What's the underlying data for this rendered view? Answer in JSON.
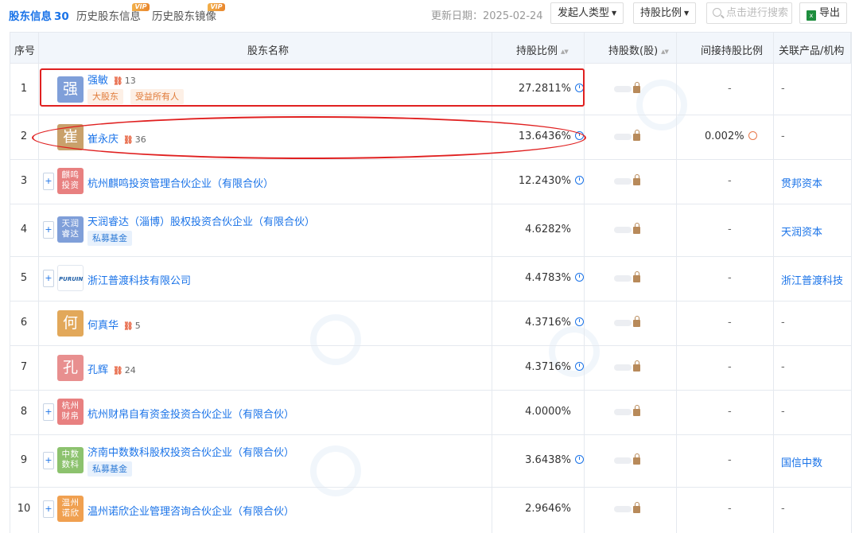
{
  "tabs": [
    {
      "label": "股东信息",
      "count": "30"
    },
    {
      "label": "历史股东信息",
      "badge": "VIP"
    },
    {
      "label": "历史股东镜像",
      "badge": "VIP"
    }
  ],
  "update_date": "更新日期：2025-02-24",
  "toolbar": {
    "sponsor_type": "发起人类型",
    "holding_ratio": "持股比例",
    "search_placeholder": "点击进行搜索",
    "export": "导出"
  },
  "columns": {
    "index": "序号",
    "name": "股东名称",
    "ratio": "持股比例",
    "shares": "持股数(股)",
    "indirect": "间接持股比例",
    "related": "关联产品/机构"
  },
  "rows": [
    {
      "index": "1",
      "avatar": "强",
      "avatar_color": "#7f9fd9",
      "name": "强敏",
      "rel_count": "13",
      "tags": [
        "大股东",
        "受益所有人"
      ],
      "ratio": "27.2811%",
      "indirect": "-",
      "related": "-"
    },
    {
      "index": "2",
      "avatar": "崔",
      "avatar_color": "#c9a16b",
      "name": "崔永庆",
      "rel_count": "36",
      "ratio": "13.6436%",
      "indirect": "0.002%",
      "related": "-"
    },
    {
      "index": "3",
      "avatar": "麒鸣投资",
      "avatar_color": "#e88080",
      "name": "杭州麒鸣投资管理合伙企业（有限合伙）",
      "ratio": "12.2430%",
      "indirect": "-",
      "related": "贯邦资本"
    },
    {
      "index": "4",
      "avatar": "天润睿达",
      "avatar_color": "#7f9fd9",
      "name": "天润睿达（淄博）股权投资合伙企业（有限合伙）",
      "tags": [
        "私募基金"
      ],
      "ratio": "4.6282%",
      "indirect": "-",
      "related": "天润资本"
    },
    {
      "index": "5",
      "avatar": "PURUIN",
      "avatar_color": "#ffffff",
      "name": "浙江普渡科技有限公司",
      "ratio": "4.4783%",
      "indirect": "-",
      "related": "浙江普渡科技"
    },
    {
      "index": "6",
      "avatar": "何",
      "avatar_color": "#e2a85a",
      "name": "何真华",
      "rel_count": "5",
      "ratio": "4.3716%",
      "indirect": "-",
      "related": "-"
    },
    {
      "index": "7",
      "avatar": "孔",
      "avatar_color": "#e88f8f",
      "name": "孔辉",
      "rel_count": "24",
      "ratio": "4.3716%",
      "indirect": "-",
      "related": "-"
    },
    {
      "index": "8",
      "avatar": "杭州财帛",
      "avatar_color": "#e88080",
      "name": "杭州财帛自有资金投资合伙企业（有限合伙）",
      "ratio": "4.0000%",
      "indirect": "-",
      "related": "-"
    },
    {
      "index": "9",
      "avatar": "中数数科",
      "avatar_color": "#8cc26e",
      "name": "济南中数数科股权投资合伙企业（有限合伙）",
      "tags": [
        "私募基金"
      ],
      "ratio": "3.6438%",
      "indirect": "-",
      "related": "国信中数"
    },
    {
      "index": "10",
      "avatar": "温州诺欣",
      "avatar_color": "#f0a050",
      "name": "温州诺欣企业管理咨询合伙企业（有限合伙）",
      "ratio": "2.9646%",
      "indirect": "-",
      "related": "-"
    }
  ]
}
